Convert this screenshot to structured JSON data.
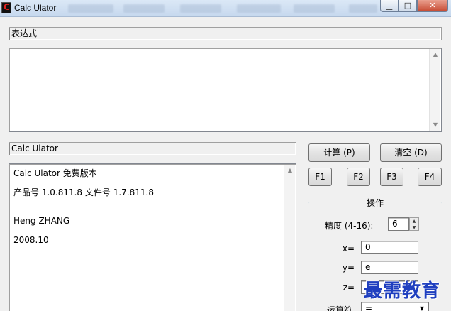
{
  "window": {
    "title": "Calc Ulator",
    "app_icon_letter": "C",
    "background_tabs": [
      "Comenlo ll",
      "Disna 1.0",
      "Budget 1",
      "PerfectCal",
      "Gadmy 2.0",
      "Preset"
    ],
    "controls": {
      "minimize": "▁",
      "maximize": "□",
      "close": "✕"
    }
  },
  "expression": {
    "label": "表达式",
    "value": ""
  },
  "info": {
    "label": "Calc Ulator",
    "lines": [
      "Calc Ulator 免费版本",
      "产品号 1.0.811.8  文件号 1.7.811.8",
      "Heng ZHANG",
      "2008.10"
    ]
  },
  "buttons": {
    "calculate": "计算 (P)",
    "clear": "清空 (D)",
    "f1": "F1",
    "f2": "F2",
    "f3": "F3",
    "f4": "F4"
  },
  "operations": {
    "title": "操作",
    "precision_label": "精度 (4-16):",
    "precision_value": "6",
    "x_label": "x=",
    "x_value": "0",
    "y_label": "y=",
    "y_value": "e",
    "z_label": "z=",
    "z_value": "",
    "operator_label": "运算符",
    "operator_value": "="
  },
  "watermark": "最需教育",
  "colors": {
    "titlebar": "#c6d8ee",
    "close_button": "#c74a32",
    "watermark": "#1f3fbf"
  }
}
